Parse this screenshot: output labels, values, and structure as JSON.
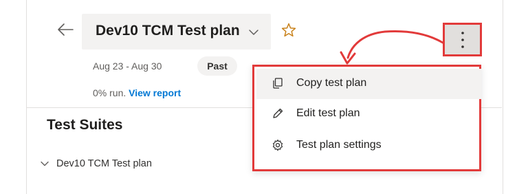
{
  "header": {
    "plan_title": "Dev10 TCM Test plan",
    "dates": "Aug 23 - Aug 30",
    "status_badge": "Past",
    "run_text": "0% run.",
    "view_report_label": "View report"
  },
  "suites": {
    "heading": "Test Suites",
    "items": [
      {
        "label": "Dev10 TCM Test plan"
      }
    ]
  },
  "more_menu": {
    "items": [
      {
        "label": "Copy test plan",
        "icon": "copy-icon"
      },
      {
        "label": "Edit test plan",
        "icon": "pencil-icon"
      },
      {
        "label": "Test plan settings",
        "icon": "gear-icon"
      }
    ]
  },
  "colors": {
    "annotation_red": "#e23a3a",
    "link_blue": "#0078d4",
    "star_orange": "#c8811a"
  }
}
